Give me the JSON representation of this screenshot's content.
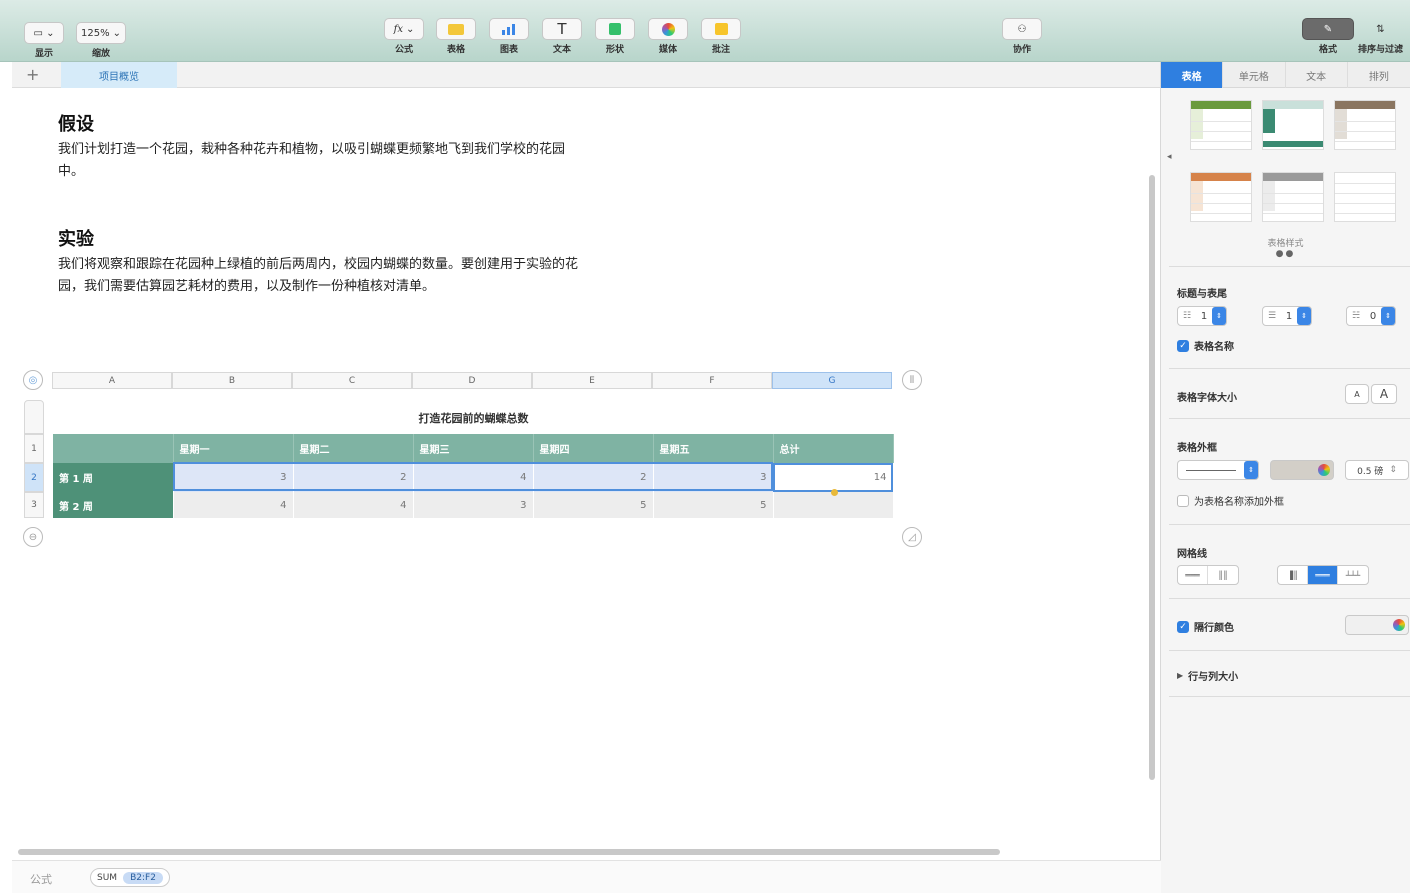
{
  "toolbar": {
    "view_label": "显示",
    "zoom_value": "125%",
    "zoom_label": "缩放",
    "formula_label": "公式",
    "table_label": "表格",
    "chart_label": "图表",
    "text_label": "文本",
    "shape_label": "形状",
    "media_label": "媒体",
    "comment_label": "批注",
    "collab_label": "协作",
    "format_label": "格式",
    "sort_label": "排序与过滤",
    "fx_glyph": "fx",
    "text_glyph": "T"
  },
  "tabs": {
    "add": "+",
    "sheet": "项目概览"
  },
  "document": {
    "section1_title": "假设",
    "section1_body": "我们计划打造一个花园，栽种各种花卉和植物，以吸引蝴蝶更频繁地飞到我们学校的花园中。",
    "section2_title": "实验",
    "section2_body": "我们将观察和跟踪在花园种上绿植的前后两周内，校园内蝴蝶的数量。要创建用于实验的花园，我们需要估算园艺耗材的费用，以及制作一份种植核对清单。"
  },
  "table": {
    "column_letters": [
      "A",
      "B",
      "C",
      "D",
      "E",
      "F",
      "G"
    ],
    "row_numbers": [
      "1",
      "2",
      "3"
    ],
    "title": "打造花园前的蝴蝶总数",
    "headers": [
      "",
      "星期一",
      "星期二",
      "星期三",
      "星期四",
      "星期五",
      "总计"
    ],
    "rows": [
      {
        "label": "第 1 周",
        "values": [
          "3",
          "2",
          "4",
          "2",
          "3"
        ],
        "total": "14"
      },
      {
        "label": "第 2 周",
        "values": [
          "4",
          "4",
          "3",
          "5",
          "5"
        ],
        "total": ""
      }
    ]
  },
  "formula_bar": {
    "label": "公式",
    "function": "SUM",
    "range": "B2:F2"
  },
  "inspector": {
    "tabs": [
      "表格",
      "单元格",
      "文本",
      "排列"
    ],
    "styles_label": "表格样式",
    "headers_section": "标题与表尾",
    "header_rows": "1",
    "header_cols": "1",
    "footer_rows": "0",
    "table_name_check": "表格名称",
    "font_size_section": "表格字体大小",
    "font_small": "A",
    "font_large": "A",
    "outline_section": "表格外框",
    "outline_width": "0.5 磅",
    "outline_name_check": "为表格名称添加外框",
    "gridlines_section": "网格线",
    "alternate_rows": "隔行颜色",
    "row_col_size": "行与列大小"
  },
  "colors": {
    "header_green": "#7fb3a3",
    "row_label_green": "#4e9178",
    "accent_blue": "#2f7fe0"
  }
}
